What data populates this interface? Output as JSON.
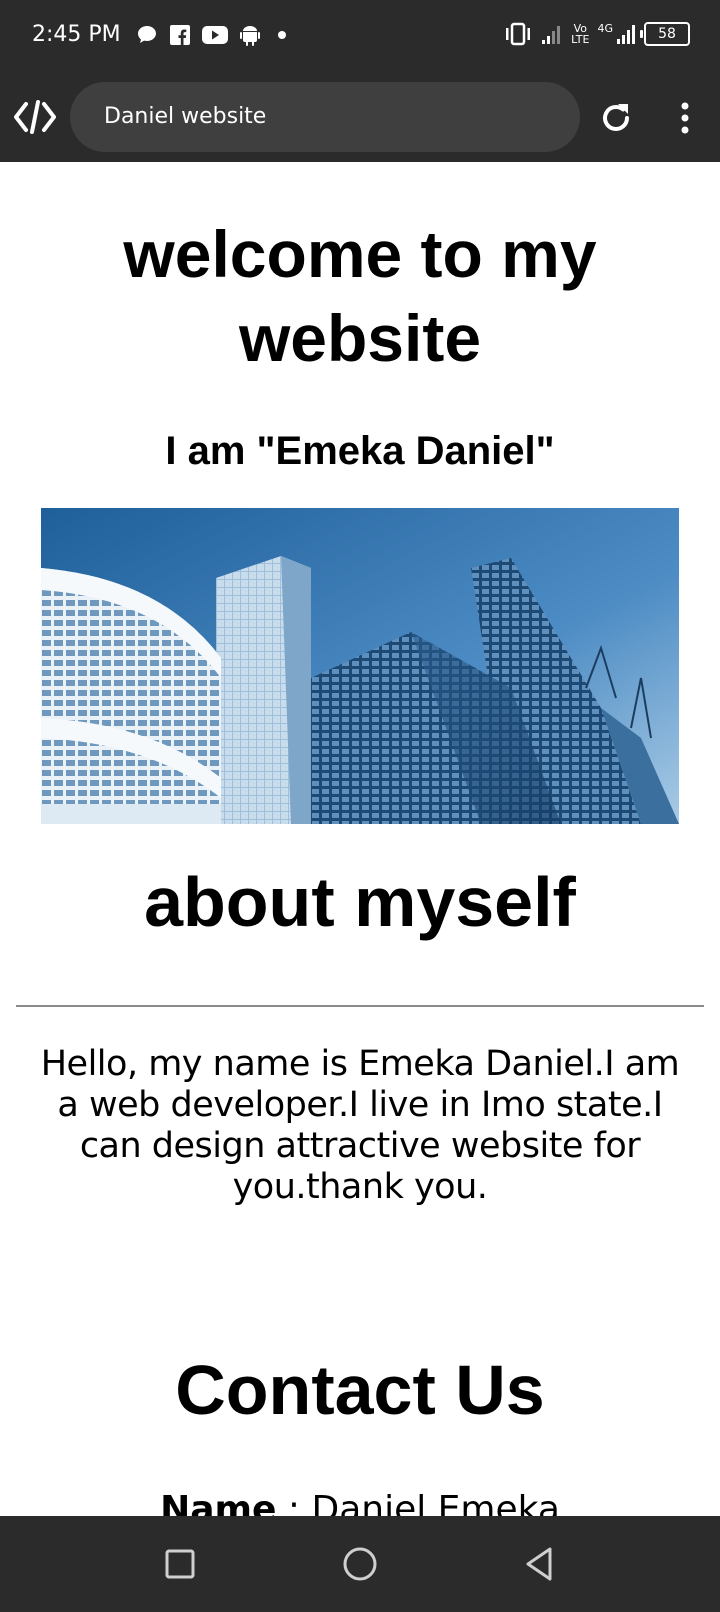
{
  "status_bar": {
    "time": "2:45 PM",
    "left_icons": [
      "chat-bubble-icon",
      "facebook-icon",
      "youtube-icon",
      "android-icon",
      "dot-icon"
    ],
    "right_icons": [
      "vibrate-icon",
      "signal-icon",
      "volte-icon",
      "4g-signal-icon",
      "battery-icon"
    ],
    "volte_label_top": "Vo",
    "volte_label_bottom": "LTE",
    "network_label": "4G",
    "battery_level": "58"
  },
  "browser": {
    "address_text": "Daniel website",
    "icons": [
      "browser-logo-icon",
      "reload-icon",
      "more-vert-icon"
    ]
  },
  "page": {
    "title": "welcome to my website",
    "subtitle": "I am \"Emeka Daniel\"",
    "hero_image_alt": "city-skyscrapers",
    "about_heading": "about myself",
    "about_text": "Hello, my name is Emeka Daniel.I am a web developer.I live in Imo state.I can design attractive website for you.thank you.",
    "contact_heading": "Contact Us",
    "contact_partial_label": "Name",
    "contact_partial_value": "Daniel Emeka"
  },
  "nav_bar": {
    "icons": [
      "recents-square-icon",
      "home-circle-icon",
      "back-triangle-icon"
    ]
  },
  "colors": {
    "chrome_bg": "#2b2b2b",
    "address_bg": "#3f3f3f",
    "page_bg": "#ffffff",
    "text": "#000000",
    "sky_blue": "#2f6fa5"
  }
}
